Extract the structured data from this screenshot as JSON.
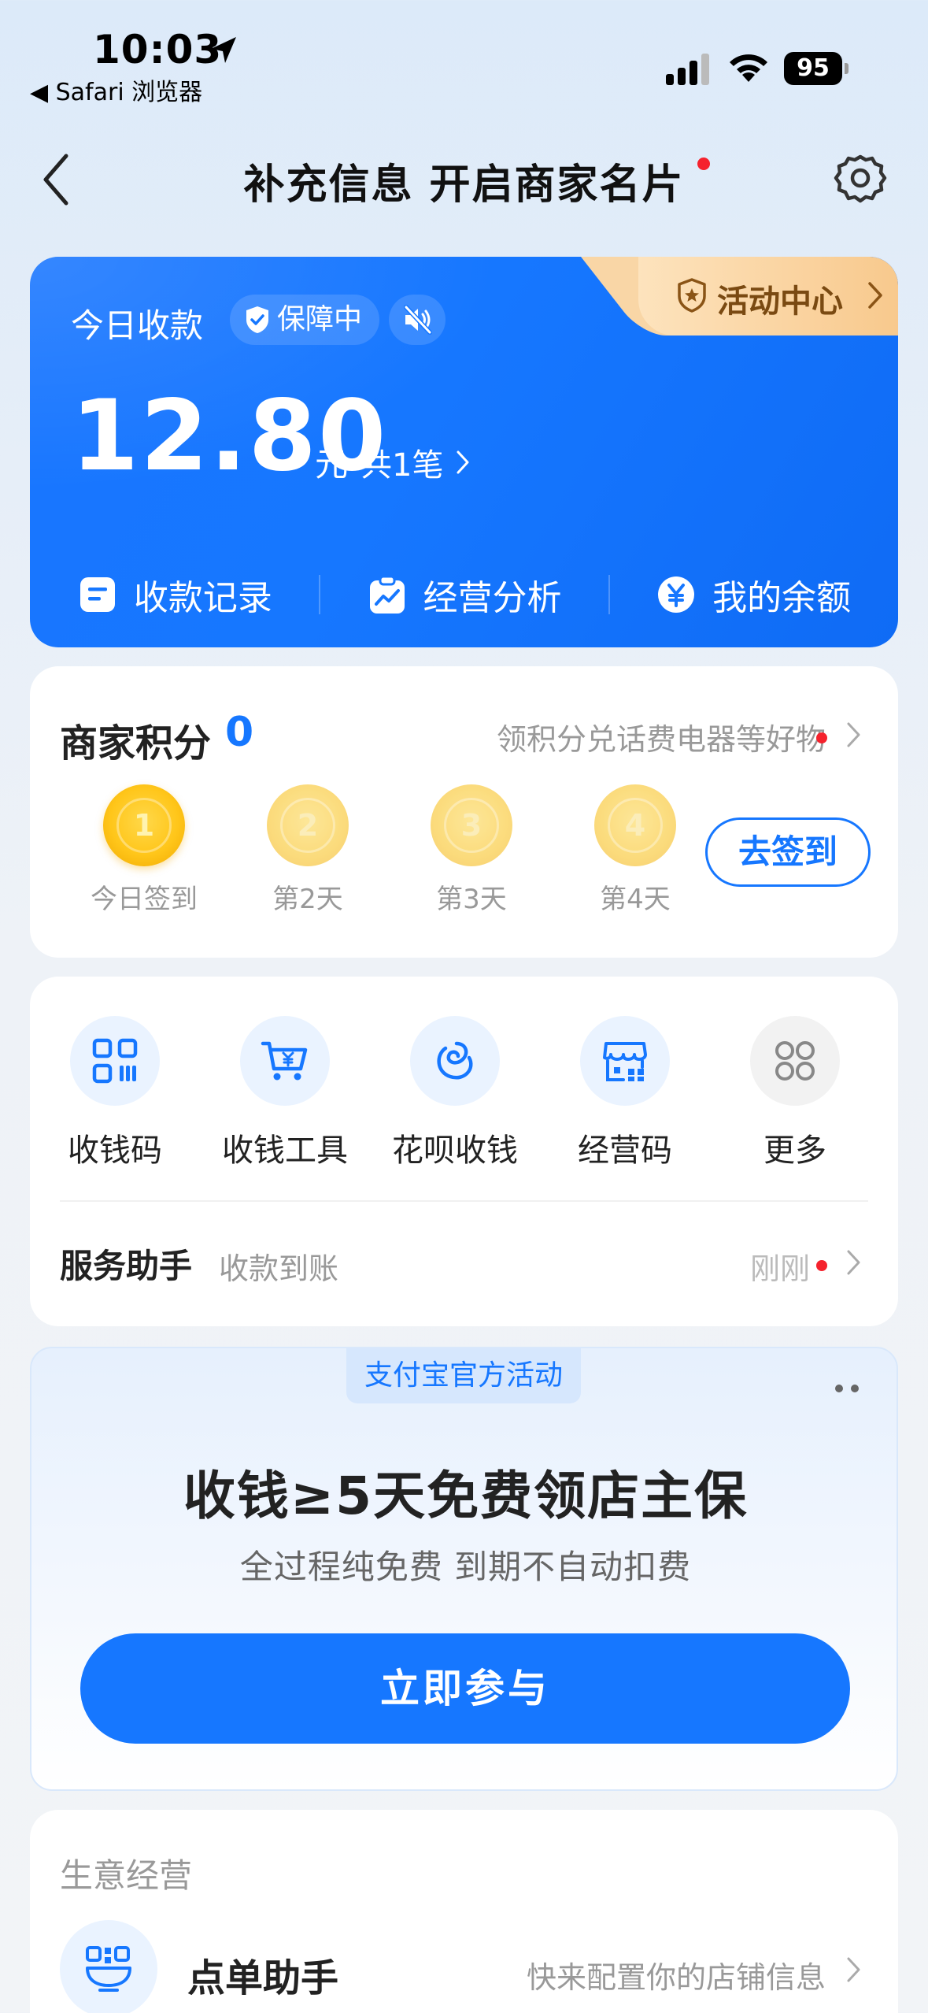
{
  "status_bar": {
    "time": "10:03",
    "back_app": "◀ Safari 浏览器",
    "battery": "95"
  },
  "nav": {
    "title": "补充信息 开启商家名片"
  },
  "earnings": {
    "today_label": "今日收款",
    "guard_label": "保障中",
    "activity_label": "活动中心",
    "amount": "12.80",
    "unit": "元",
    "count": "共1笔",
    "actions": [
      {
        "label": "收款记录",
        "icon": "receipt-icon"
      },
      {
        "label": "经营分析",
        "icon": "analysis-icon"
      },
      {
        "label": "我的余额",
        "icon": "yuan-icon"
      }
    ]
  },
  "points": {
    "title": "商家积分",
    "value": "0",
    "hint": "领积分兑话费电器等好物",
    "days": [
      {
        "num": "1",
        "label": "今日签到",
        "active": true
      },
      {
        "num": "2",
        "label": "第2天",
        "active": false
      },
      {
        "num": "3",
        "label": "第3天",
        "active": false
      },
      {
        "num": "4",
        "label": "第4天",
        "active": false
      }
    ],
    "signin_label": "去签到"
  },
  "tools": {
    "items": [
      {
        "label": "收钱码",
        "icon": "qr-code-icon"
      },
      {
        "label": "收钱工具",
        "icon": "cart-yuan-icon"
      },
      {
        "label": "花呗收钱",
        "icon": "huabei-icon"
      },
      {
        "label": "经营码",
        "icon": "store-code-icon"
      },
      {
        "label": "更多",
        "icon": "more-grid-icon"
      }
    ],
    "service_title": "服务助手",
    "service_sub": "收款到账",
    "service_time": "刚刚"
  },
  "promo": {
    "tag": "支付宝官方活动",
    "title": "收钱≥5天免费领店主保",
    "subtitle": "全过程纯免费 到期不自动扣费",
    "button": "立即参与"
  },
  "business": {
    "section_title": "生意经营",
    "item_name": "点单助手",
    "item_hint": "快来配置你的店铺信息"
  },
  "colors": {
    "brand_blue": "#1677ff",
    "alert_red": "#f5222d",
    "coin_gold": "#ffc61a"
  }
}
